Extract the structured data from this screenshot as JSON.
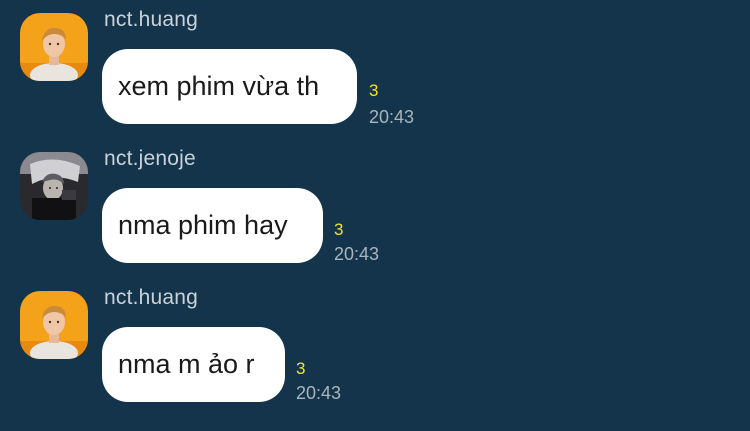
{
  "colors": {
    "background": "#13344a",
    "bubble": "#ffffff",
    "unread": "#f2e32a",
    "timestamp": "#a9b4bd",
    "sender": "#c9d2da"
  },
  "messages": [
    {
      "sender": "nct.huang",
      "avatar_icon": "orange-portrait-avatar",
      "text": "xem phim vừa th",
      "unread": "3",
      "time": "20:43"
    },
    {
      "sender": "nct.jenoje",
      "avatar_icon": "dark-portrait-avatar",
      "text": "nma phim hay",
      "unread": "3",
      "time": "20:43"
    },
    {
      "sender": "nct.huang",
      "avatar_icon": "orange-portrait-avatar",
      "text": "nma m ảo r",
      "unread": "3",
      "time": "20:43"
    }
  ]
}
